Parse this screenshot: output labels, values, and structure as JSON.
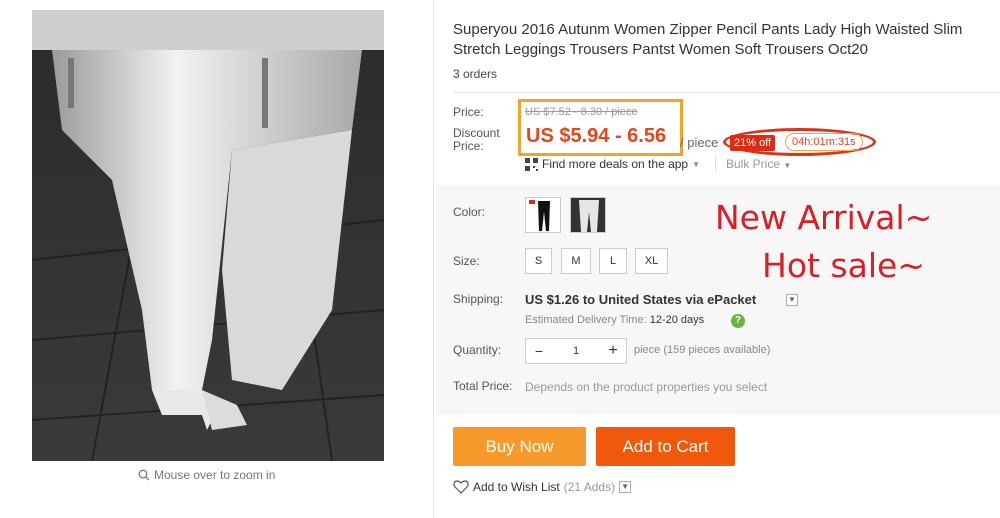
{
  "gallery": {
    "zoom_hint": "Mouse over to zoom in"
  },
  "product": {
    "title": "Superyou 2016 Autunm Women Zipper Pencil Pants Lady High Waisted Slim Stretch Leggings Trousers Pantst Women Soft Trousers Oct20",
    "orders": "3 orders"
  },
  "pricing": {
    "price_label": "Price:",
    "original_price": "US $7.52 - 8.30 / piece",
    "discount_label_1": "Discount",
    "discount_label_2": "Price:",
    "discount_price": "US $5.94 - 6.56",
    "per_piece": "/ piece",
    "off_badge": "21% off",
    "countdown": "04h:01m:31s",
    "app_deals": "Find more deals on the app",
    "bulk_price": "Bulk Price"
  },
  "options": {
    "color_label": "Color:",
    "size_label": "Size:",
    "sizes": [
      "S",
      "M",
      "L",
      "XL"
    ]
  },
  "promo": {
    "line1": "New Arrival~",
    "line2": "Hot sale~"
  },
  "shipping": {
    "label": "Shipping:",
    "text": "US $1.26 to United States via ePacket",
    "est_label": "Estimated Delivery Time:",
    "est_value": "12-20 days"
  },
  "quantity": {
    "label": "Quantity:",
    "value": "1",
    "minus": "−",
    "plus": "+",
    "note": "piece (159 pieces available)"
  },
  "total": {
    "label": "Total Price:",
    "note": "Depends on the product properties you select"
  },
  "actions": {
    "buy_now": "Buy Now",
    "add_to_cart": "Add to Cart",
    "wishlist": "Add to Wish List",
    "wishlist_count": "(21 Adds)"
  },
  "colors": {
    "price_orange": "#e5451a",
    "buy_now_bg": "#f79a2b",
    "add_to_cart_bg": "#f0580c",
    "promo_red": "#d81e26"
  }
}
